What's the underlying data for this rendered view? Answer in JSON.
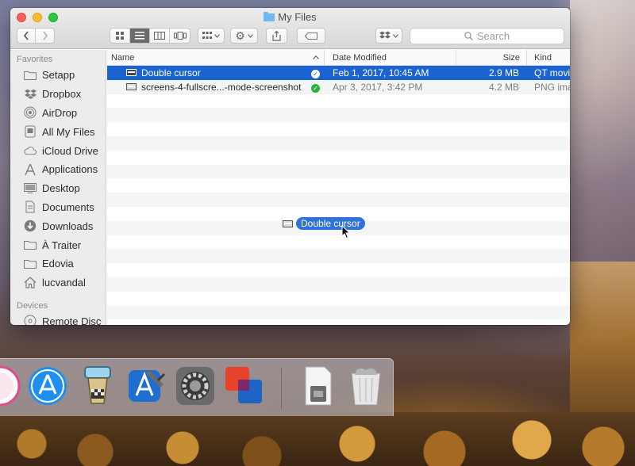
{
  "window": {
    "title": "My Files"
  },
  "toolbar": {
    "search_placeholder": "Search"
  },
  "sidebar": {
    "favorites_heading": "Favorites",
    "items": [
      {
        "label": "Setapp",
        "icon": "folder-icon"
      },
      {
        "label": "Dropbox",
        "icon": "dropbox-icon"
      },
      {
        "label": "AirDrop",
        "icon": "airdrop-icon"
      },
      {
        "label": "All My Files",
        "icon": "all-files-icon"
      },
      {
        "label": "iCloud Drive",
        "icon": "cloud-icon"
      },
      {
        "label": "Applications",
        "icon": "applications-icon"
      },
      {
        "label": "Desktop",
        "icon": "desktop-icon"
      },
      {
        "label": "Documents",
        "icon": "documents-icon"
      },
      {
        "label": "Downloads",
        "icon": "downloads-icon"
      },
      {
        "label": "À Traiter",
        "icon": "folder-icon"
      },
      {
        "label": "Edovia",
        "icon": "folder-icon"
      },
      {
        "label": "lucvandal",
        "icon": "home-icon"
      }
    ],
    "devices_heading": "Devices",
    "devices": [
      {
        "label": "Remote Disc",
        "icon": "disc-icon"
      }
    ]
  },
  "columns": {
    "name": "Name",
    "date": "Date Modified",
    "size": "Size",
    "kind": "Kind"
  },
  "files": [
    {
      "name": "Double cursor",
      "date": "Feb 1, 2017, 10:45 AM",
      "size": "2.9 MB",
      "kind": "QT movie",
      "selected": true
    },
    {
      "name": "screens-4-fullscre...-mode-screenshot",
      "date": "Apr 3, 2017, 3:42 PM",
      "size": "4.2 MB",
      "kind": "PNG image",
      "selected": false
    }
  ],
  "drag": {
    "label": "Double cursor"
  },
  "dock": {
    "items": [
      "itunes-icon",
      "app-store-icon",
      "transmit-icon",
      "xcode-icon",
      "system-preferences-icon",
      "vmware-fusion-icon",
      "archive-utility-icon",
      "trash-icon"
    ]
  },
  "colors": {
    "selection": "#1b63d1",
    "sync_ok": "#27b43c"
  }
}
